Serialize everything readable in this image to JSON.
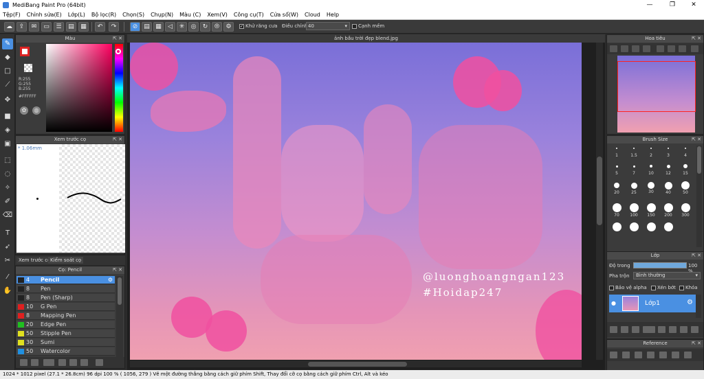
{
  "window": {
    "title": "MediBang Paint Pro (64bit)",
    "min": "—",
    "max": "❐",
    "close": "✕"
  },
  "menu": [
    "Tệp(F)",
    "Chỉnh sửa(E)",
    "Lớp(L)",
    "Bộ lọc(R)",
    "Chọn(S)",
    "Chụp(N)",
    "Màu (C)",
    "Xem(V)",
    "Công cụ(T)",
    "Cửa sổ(W)",
    "Cloud",
    "Help"
  ],
  "toolbar": {
    "antialias_label": "Khử răng cưa",
    "adjust_label": "Điều chỉnh",
    "adjust_value": "40",
    "snap_label": "Cạnh mềm"
  },
  "color_panel": {
    "title": "Màu",
    "r": "R:255",
    "g": "G:255",
    "b": "B:255",
    "hex": "#FFFFFF",
    "accent": "#4a90e2"
  },
  "brush_preview": {
    "title": "Xem trước cọ",
    "size": "1.06mm",
    "tab1": "Xem trước cọ",
    "tab2": "Kiểm soát cọ"
  },
  "brush_list": {
    "title": "Cọ: Pencil",
    "items": [
      {
        "size": "4",
        "name": "Pencil",
        "color": "#222222",
        "selected": true
      },
      {
        "size": "8",
        "name": "Pen",
        "color": "#222222"
      },
      {
        "size": "8",
        "name": "Pen (Sharp)",
        "color": "#222222"
      },
      {
        "size": "10",
        "name": "G Pen",
        "color": "#e02020"
      },
      {
        "size": "8",
        "name": "Mapping Pen",
        "color": "#e02020"
      },
      {
        "size": "20",
        "name": "Edge Pen",
        "color": "#20c020"
      },
      {
        "size": "50",
        "name": "Stipple Pen",
        "color": "#e0e020"
      },
      {
        "size": "30",
        "name": "Sumi",
        "color": "#e0e020"
      },
      {
        "size": "50",
        "name": "Watercolor",
        "color": "#2090e0"
      }
    ]
  },
  "canvas": {
    "filename": "ảnh bầu trời đẹp blend.jpg",
    "watermark1": "@luonghoangngan123",
    "watermark2": "#Hoidap247"
  },
  "navigator": {
    "title": "Hoa tiêu"
  },
  "brush_size": {
    "title": "Brush Size",
    "labels": [
      "1",
      "1.5",
      "2",
      "3",
      "4",
      "5",
      "7",
      "10",
      "12",
      "15",
      "20",
      "25",
      "30",
      "40",
      "50",
      "70",
      "100",
      "150",
      "200",
      "300",
      "",
      "",
      "",
      ""
    ]
  },
  "layers": {
    "title": "Lớp",
    "opacity_label": "Độ trong",
    "opacity_value": "100 %",
    "blend_label": "Pha trộn",
    "blend_value": "Bình thường",
    "protect_alpha": "Bảo vệ alpha",
    "clipping": "Xén bớt",
    "lock": "Khóa",
    "layer_name": "Lớp1",
    "opacity_fraction": 1.0
  },
  "reference": {
    "title": "Reference"
  },
  "status": {
    "text": "1024 * 1012 pixel   (27.1 * 26.8cm)   96 dpi   100 %   ( 1056, 279 )   Vẽ một đường thẳng bằng cách giữ phím Shift, Thay đổi cỡ cọ bằng cách giữ phím Ctrl, Alt và kéo"
  }
}
